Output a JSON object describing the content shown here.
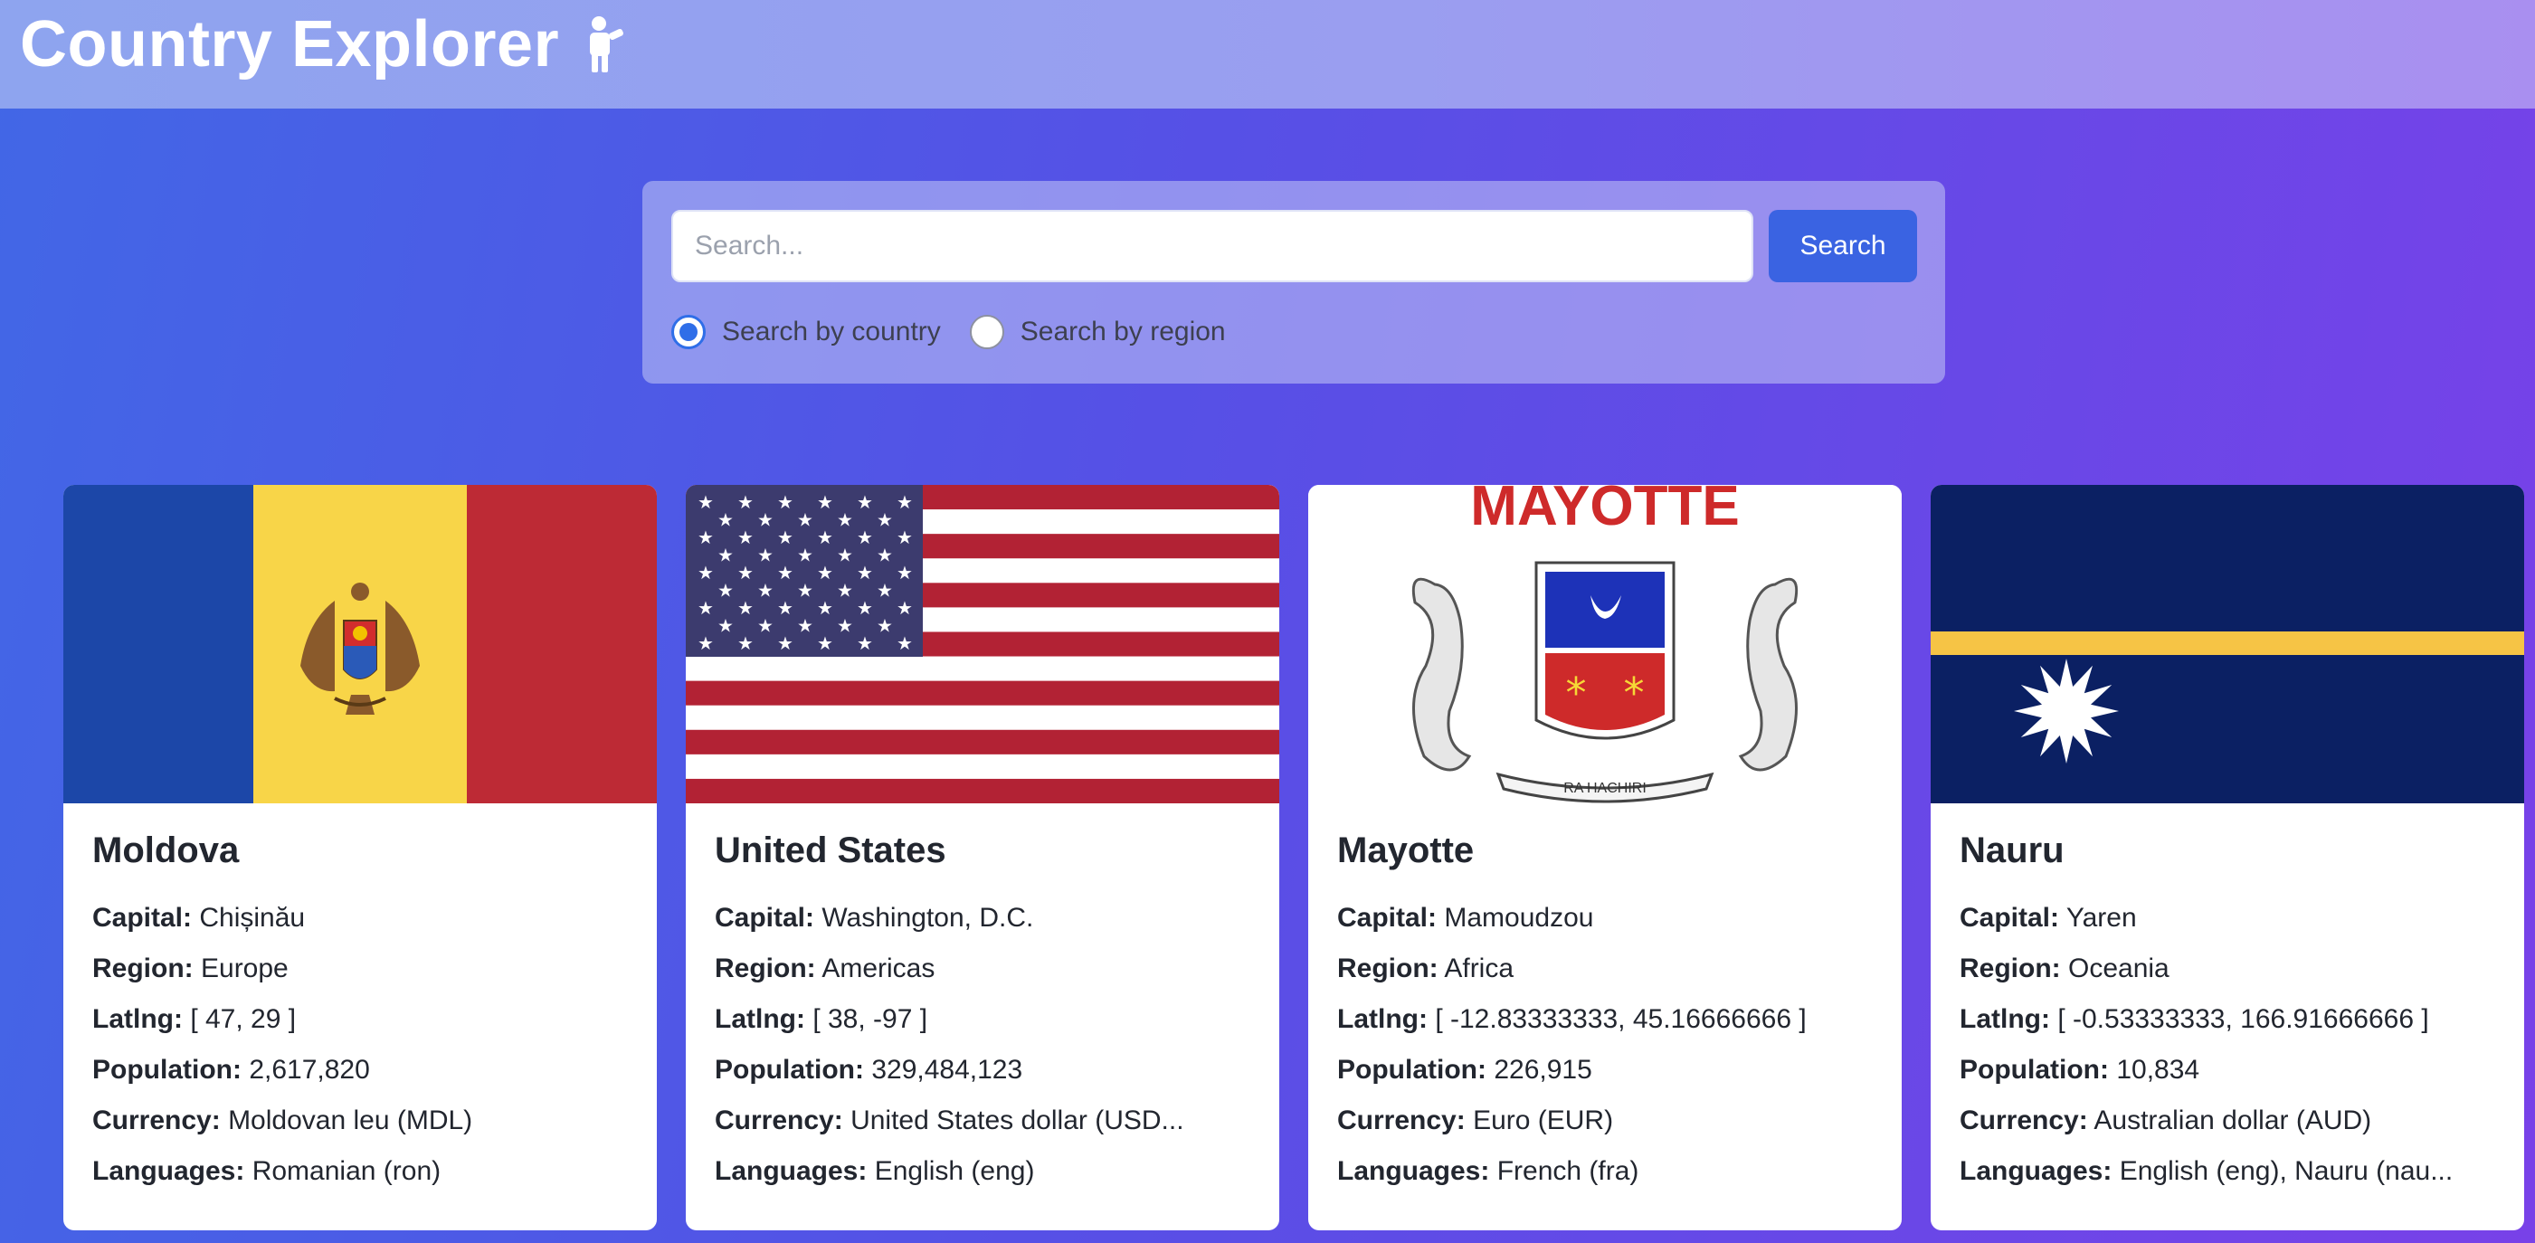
{
  "app": {
    "title": "Country Explorer",
    "title_icon": "explorer-person-icon"
  },
  "search": {
    "placeholder": "Search...",
    "value": "",
    "button_label": "Search",
    "options": [
      {
        "label": "Search by country",
        "checked": true
      },
      {
        "label": "Search by region",
        "checked": false
      }
    ]
  },
  "labels": {
    "capital": "Capital:",
    "region": "Region:",
    "latlng": "Latlng:",
    "population": "Population:",
    "currency": "Currency:",
    "languages": "Languages:"
  },
  "countries": [
    {
      "name": "Moldova",
      "capital": "Chișinău",
      "region": "Europe",
      "latlng": "[ 47, 29 ]",
      "population": "2,617,820",
      "currency": "Moldovan leu (MDL)",
      "languages": "Romanian (ron)",
      "flag_icon": "moldova-flag",
      "flag_colors": [
        "#1c47a8",
        "#f8d548",
        "#bd2a35"
      ]
    },
    {
      "name": "United States",
      "capital": "Washington, D.C.",
      "region": "Americas",
      "latlng": "[ 38, -97 ]",
      "population": "329,484,123",
      "currency": "United States dollar (USD...",
      "languages": "English (eng)",
      "flag_icon": "united-states-flag",
      "flag_colors": [
        "#b22234",
        "#ffffff",
        "#3c3b6e"
      ]
    },
    {
      "name": "Mayotte",
      "capital": "Mamoudzou",
      "region": "Africa",
      "latlng": "[ -12.83333333, 45.16666666 ]",
      "population": "226,915",
      "currency": "Euro (EUR)",
      "languages": "French (fra)",
      "flag_icon": "mayotte-flag",
      "flag_text": "MAYOTTE",
      "flag_motto": "RA HACHIRI",
      "flag_colors": [
        "#ce2a2a",
        "#1d32b8",
        "#ffffff"
      ]
    },
    {
      "name": "Nauru",
      "capital": "Yaren",
      "region": "Oceania",
      "latlng": "[ -0.53333333, 166.91666666 ]",
      "population": "10,834",
      "currency": "Australian dollar (AUD)",
      "languages": "English (eng), Nauru (nau...",
      "flag_icon": "nauru-flag",
      "flag_colors": [
        "#0b2063",
        "#f6c445",
        "#ffffff"
      ]
    }
  ]
}
